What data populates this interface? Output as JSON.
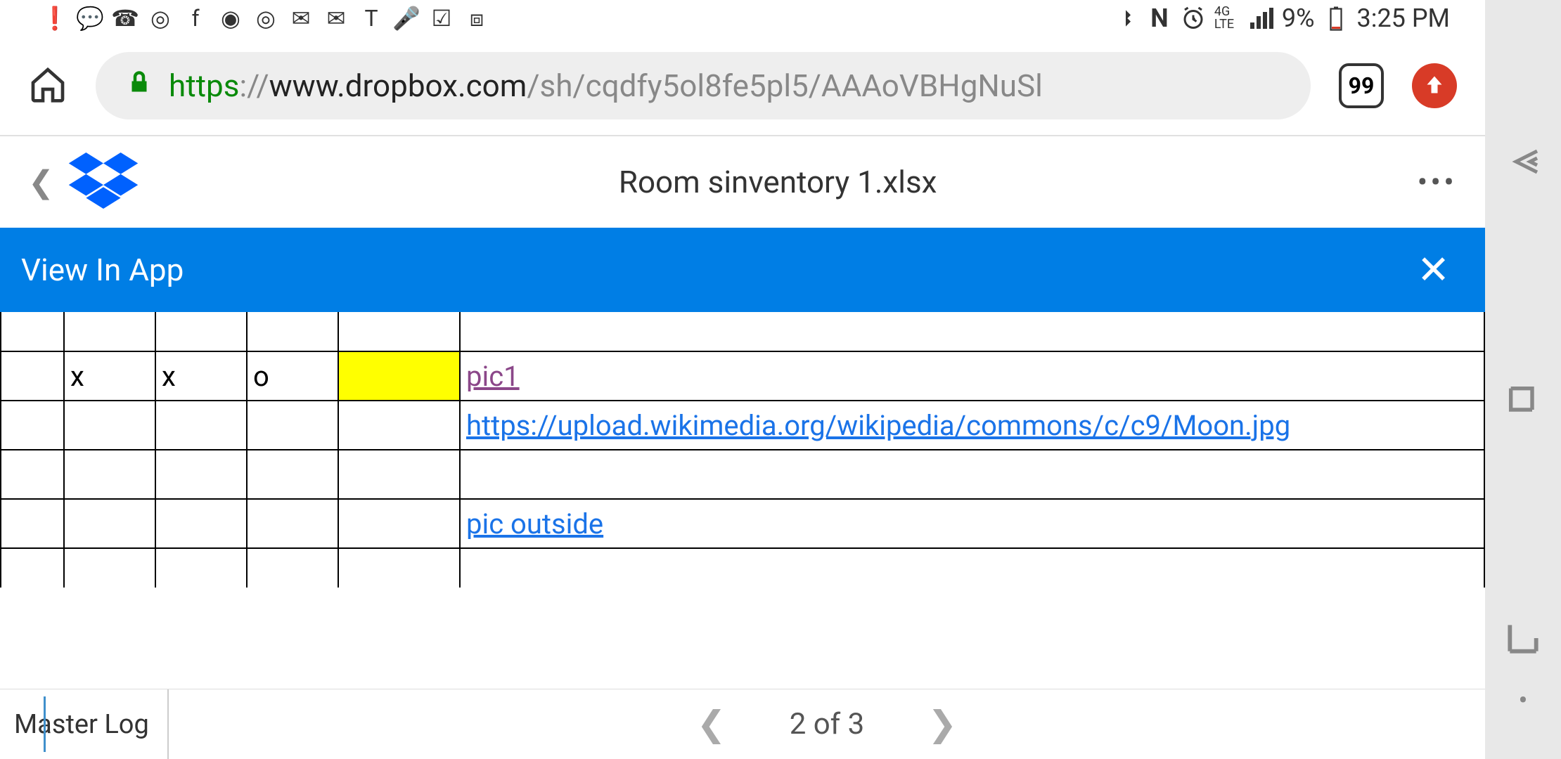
{
  "status_bar": {
    "battery_pct": "9%",
    "time": "3:25 PM",
    "network": "4G LTE"
  },
  "browser": {
    "url_scheme": "https",
    "url_gray1": "://",
    "url_host": "www.dropbox.com",
    "url_path": "/sh/cqdfy5ol8fe5pl5/AAAoVBHgNuSl",
    "tab_count": "99"
  },
  "dropbox": {
    "file_name": "Room sinventory 1.xlsx",
    "banner_text": "View In App"
  },
  "sheet": {
    "rows": [
      {
        "a": "",
        "b": "",
        "c": "",
        "d": "",
        "e": "",
        "f": ""
      },
      {
        "a": "",
        "b": "x",
        "c": "x",
        "d": "o",
        "e": "",
        "f": "pic1",
        "f_link": "visited"
      },
      {
        "a": "",
        "b": "",
        "c": "",
        "d": "",
        "e": "",
        "f": "https://upload.wikimedia.org/wikipedia/commons/c/c9/Moon.jpg",
        "f_link": "blue"
      },
      {
        "a": "",
        "b": "",
        "c": "",
        "d": "",
        "e": "",
        "f": ""
      },
      {
        "a": "",
        "b": "",
        "c": "",
        "d": "",
        "e": "",
        "f": "pic outside",
        "f_link": "blue"
      },
      {
        "a": "",
        "b": "",
        "c": "",
        "d": "",
        "e": "",
        "f": ""
      }
    ],
    "active_tab": "Master Log",
    "pager": "2 of 3"
  }
}
